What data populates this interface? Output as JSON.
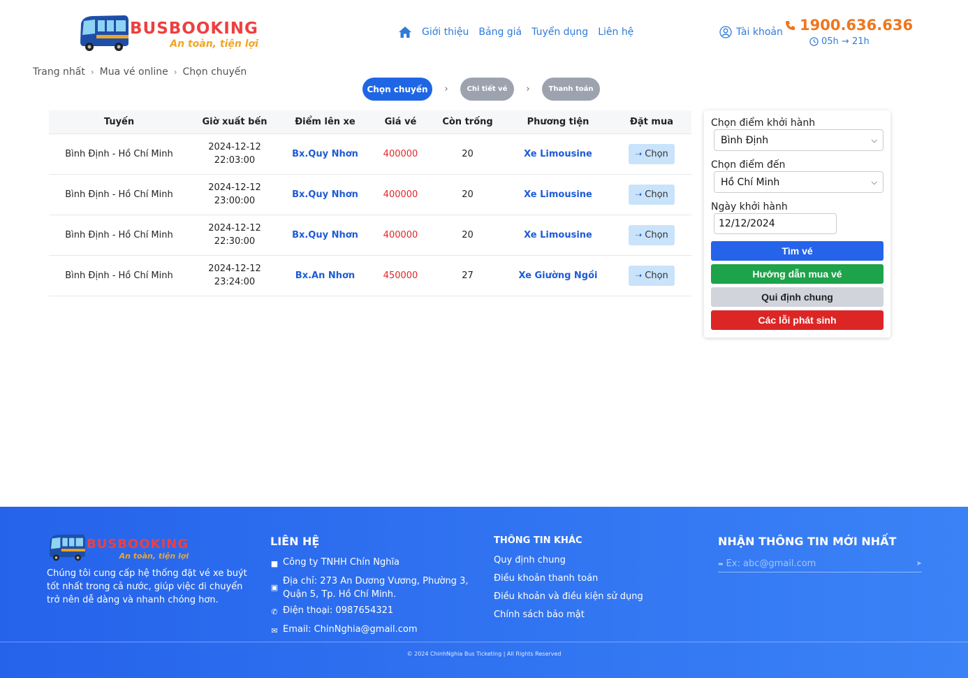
{
  "brand": {
    "name": "BUSBOOKING",
    "tagline": "An toàn, tiện lợi"
  },
  "nav": {
    "items": [
      "Giới thiệu",
      "Bảng giá",
      "Tuyển dụng",
      "Liên hệ"
    ]
  },
  "account": {
    "label": "Tài khoản"
  },
  "hotline": {
    "phone": "1900.636.636",
    "hours": "05h → 21h"
  },
  "breadcrumb": [
    "Trang nhất",
    "Mua vé online",
    "Chọn chuyến"
  ],
  "steps": [
    "Chọn chuyến",
    "Chi tiết vé",
    "Thanh toán"
  ],
  "table": {
    "headers": [
      "Tuyến",
      "Giờ xuất bến",
      "Điểm lên xe",
      "Giá vé",
      "Còn trống",
      "Phương tiện",
      "Đặt mua"
    ],
    "button_label": "Chọn",
    "rows": [
      {
        "route": "Bình Định - Hồ Chí Minh",
        "date": "2024-12-12",
        "time": "22:03:00",
        "point": "Bx.Quy Nhơn",
        "price": "400000",
        "seats": "20",
        "vehicle": "Xe Limousine"
      },
      {
        "route": "Bình Định - Hồ Chí Minh",
        "date": "2024-12-12",
        "time": "23:00:00",
        "point": "Bx.Quy Nhơn",
        "price": "400000",
        "seats": "20",
        "vehicle": "Xe Limousine"
      },
      {
        "route": "Bình Định - Hồ Chí Minh",
        "date": "2024-12-12",
        "time": "22:30:00",
        "point": "Bx.Quy Nhơn",
        "price": "400000",
        "seats": "20",
        "vehicle": "Xe Limousine"
      },
      {
        "route": "Bình Định - Hồ Chí Minh",
        "date": "2024-12-12",
        "time": "23:24:00",
        "point": "Bx.An Nhơn",
        "price": "450000",
        "seats": "27",
        "vehicle": "Xe Giường Ngồi"
      }
    ]
  },
  "search": {
    "departure_label": "Chọn điểm khởi hành",
    "departure_value": "Bình Định",
    "destination_label": "Chọn điểm đến",
    "destination_value": "Hồ Chí Minh",
    "date_label": "Ngày khởi hành",
    "date_value": "12/12/2024",
    "buttons": {
      "search": "Tìm vé",
      "guide": "Hướng dẫn mua vé",
      "rules": "Qui định chung",
      "errors": "Các lỗi phát sinh"
    }
  },
  "footer": {
    "description": "Chúng tôi cung cấp hệ thống đặt vé xe buýt tốt nhất trong cả nước, giúp việc di chuyển trở nên dễ dàng và nhanh chóng hơn.",
    "contact_title": "LIÊN HỆ",
    "company": "Công ty TNHH Chín Nghĩa",
    "address": "Địa chỉ: 273 An Dương Vương, Phường 3, Quận 5, Tp. Hồ Chí Minh.",
    "phone": "Điện thoại: 0987654321",
    "email": "Email: ChinNghia@gmail.com",
    "info_title": "THÔNG TIN KHÁC",
    "info_links": [
      "Quy định chung",
      "Điều khoản thanh toán",
      "Điều khoản và điều kiện sử dụng",
      "Chính sách bảo mật"
    ],
    "newsletter_title": "NHẬN THÔNG TIN MỚI NHẤT",
    "newsletter_placeholder": "Ex: abc@gmail.com",
    "copyright": "© 2024 ChinhNghia Bus Ticketing | All Rights Reserved"
  },
  "colors": {
    "primary": "#2563eb",
    "link": "#2f7bd9",
    "price": "#e02626",
    "hotline": "#f0761d",
    "brand_red": "#ef3f3f",
    "brand_orange": "#f0a526",
    "guide_green": "#1da34a",
    "error_red": "#dc2626"
  }
}
